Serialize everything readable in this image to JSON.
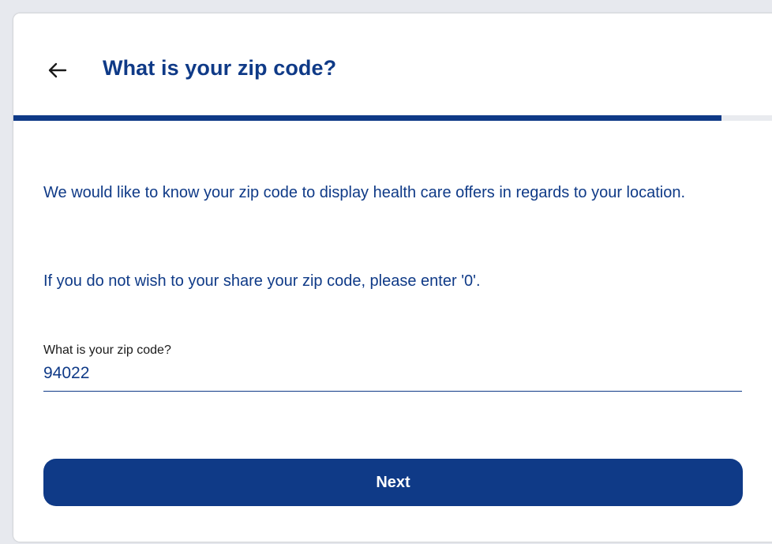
{
  "header": {
    "back_icon": "arrow-left-icon",
    "title": "What is your zip code?"
  },
  "progress": {
    "fraction": 0.92
  },
  "content": {
    "intro": "We would like to know your zip code to display health care offers in regards to your location.",
    "note": "If you do not wish to your share your zip code, please enter '0'."
  },
  "form": {
    "zip_label": "What is your zip code?",
    "zip_value": "94022"
  },
  "actions": {
    "next_label": "Next"
  },
  "colors": {
    "brand": "#0f3a87",
    "background": "#e7e9ee",
    "card": "#ffffff"
  }
}
